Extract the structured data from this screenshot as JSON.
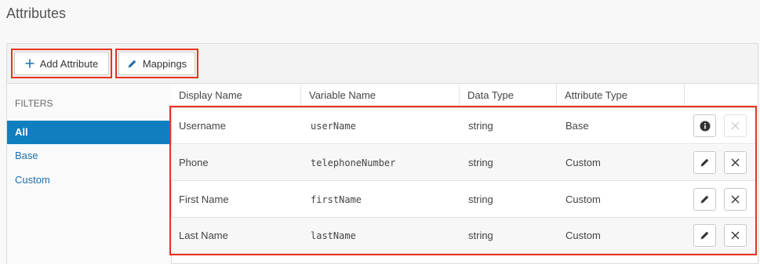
{
  "page": {
    "title": "Attributes"
  },
  "toolbar": {
    "add_label": "Add Attribute",
    "mappings_label": "Mappings"
  },
  "filters": {
    "heading": "FILTERS",
    "items": [
      {
        "label": "All",
        "active": true
      },
      {
        "label": "Base",
        "active": false
      },
      {
        "label": "Custom",
        "active": false
      }
    ]
  },
  "table": {
    "columns": [
      "Display Name",
      "Variable Name",
      "Data Type",
      "Attribute Type"
    ],
    "rows": [
      {
        "display_name": "Username",
        "variable_name": "userName",
        "data_type": "string",
        "attribute_type": "Base",
        "primary_action": "info-icon",
        "delete_enabled": false
      },
      {
        "display_name": "Phone",
        "variable_name": "telephoneNumber",
        "data_type": "string",
        "attribute_type": "Custom",
        "primary_action": "pencil-icon",
        "delete_enabled": true
      },
      {
        "display_name": "First Name",
        "variable_name": "firstName",
        "data_type": "string",
        "attribute_type": "Custom",
        "primary_action": "pencil-icon",
        "delete_enabled": true
      },
      {
        "display_name": "Last Name",
        "variable_name": "lastName",
        "data_type": "string",
        "attribute_type": "Custom",
        "primary_action": "pencil-icon",
        "delete_enabled": true
      }
    ]
  },
  "colors": {
    "accent": "#0f7fc0",
    "highlight": "#e8321f",
    "link": "#1f6fae"
  }
}
